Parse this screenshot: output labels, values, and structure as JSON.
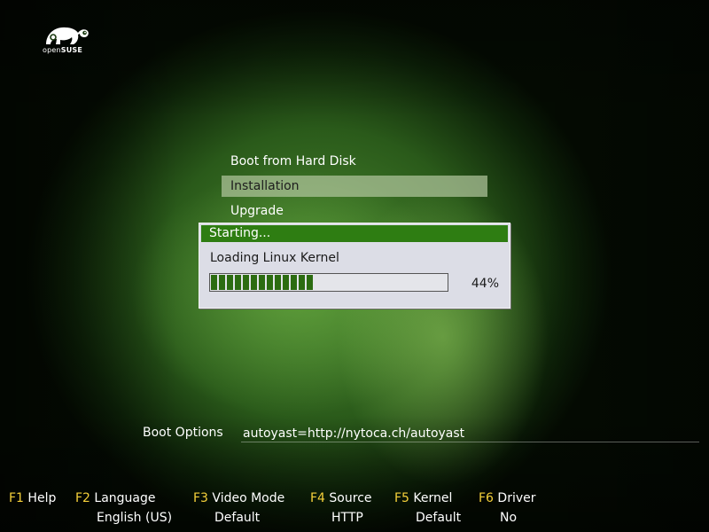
{
  "logo": {
    "icon": "gecko-icon",
    "text_open": "open",
    "text_suse": "SUSE"
  },
  "menu": {
    "items": [
      {
        "label": "Boot from Hard Disk",
        "selected": false
      },
      {
        "label": "Installation",
        "selected": true
      },
      {
        "label": "Upgrade",
        "selected": false
      }
    ]
  },
  "dialog": {
    "title": "Starting...",
    "message": "Loading Linux Kernel",
    "progress_percent": 44,
    "progress_text": "44%",
    "title_color": "#2e7d12",
    "bar_color": "#2c6c11"
  },
  "boot_options": {
    "label": "Boot Options",
    "value": "autoyast=http://nytoca.ch/autoyast"
  },
  "fkeys": [
    {
      "key": "F1",
      "label": "Help",
      "value": ""
    },
    {
      "key": "F2",
      "label": "Language",
      "value": "English (US)"
    },
    {
      "key": "F3",
      "label": "Video Mode",
      "value": "Default"
    },
    {
      "key": "F4",
      "label": "Source",
      "value": "HTTP"
    },
    {
      "key": "F5",
      "label": "Kernel",
      "value": "Default"
    },
    {
      "key": "F6",
      "label": "Driver",
      "value": "No"
    }
  ],
  "colors": {
    "fkey_accent": "#f5d03a",
    "selection_bg": "#b4c8a0"
  }
}
